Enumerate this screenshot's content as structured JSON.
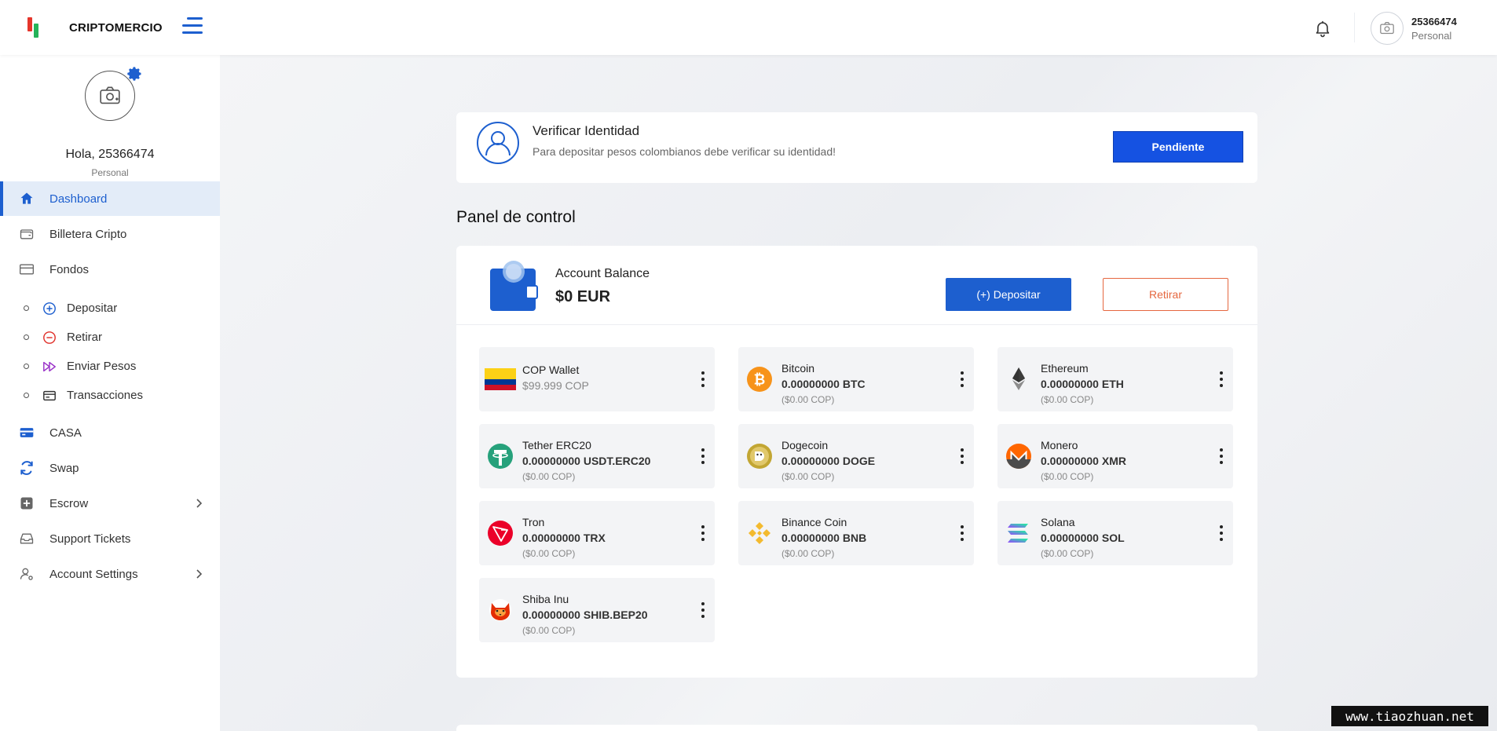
{
  "brand": {
    "name": "CRIPTOMERCIO"
  },
  "topbar": {
    "user_id": "25366474",
    "user_role": "Personal"
  },
  "profile": {
    "greeting": "Hola, 25366474",
    "role": "Personal"
  },
  "sidebar": {
    "items": [
      {
        "label": "Dashboard",
        "icon": "home-icon"
      },
      {
        "label": "Billetera Cripto",
        "icon": "wallet-icon"
      },
      {
        "label": "Fondos",
        "icon": "card-icon"
      }
    ],
    "sub_items": [
      {
        "label": "Depositar",
        "icon": "plus-circle-icon"
      },
      {
        "label": "Retirar",
        "icon": "minus-circle-icon"
      },
      {
        "label": "Enviar Pesos",
        "icon": "fast-forward-icon"
      },
      {
        "label": "Transacciones",
        "icon": "receipt-icon"
      }
    ],
    "lower_items": [
      {
        "label": "CASA",
        "icon": "credit-card-icon"
      },
      {
        "label": "Swap",
        "icon": "refresh-icon"
      },
      {
        "label": "Escrow",
        "icon": "plus-square-icon"
      },
      {
        "label": "Support Tickets",
        "icon": "inbox-icon"
      },
      {
        "label": "Account Settings",
        "icon": "user-settings-icon"
      }
    ]
  },
  "verify": {
    "title": "Verificar Identidad",
    "text": "Para depositar pesos colombianos debe verificar su identidad!",
    "button": "Pendiente"
  },
  "panel": {
    "title": "Panel de control"
  },
  "balance": {
    "label": "Account Balance",
    "value": "$0 EUR",
    "deposit_label": "(+) Depositar",
    "withdraw_label": "Retirar"
  },
  "wallets": [
    {
      "name": "COP Wallet",
      "amount": "$99.999 COP",
      "cop": "",
      "icon": "colombia-flag-icon"
    },
    {
      "name": "Bitcoin",
      "amount": "0.00000000 BTC",
      "cop": "($0.00 COP)",
      "icon": "bitcoin-icon"
    },
    {
      "name": "Ethereum",
      "amount": "0.00000000 ETH",
      "cop": "($0.00 COP)",
      "icon": "ethereum-icon"
    },
    {
      "name": "Tether ERC20",
      "amount": "0.00000000 USDT.ERC20",
      "cop": "($0.00 COP)",
      "icon": "tether-icon"
    },
    {
      "name": "Dogecoin",
      "amount": "0.00000000 DOGE",
      "cop": "($0.00 COP)",
      "icon": "dogecoin-icon"
    },
    {
      "name": "Monero",
      "amount": "0.00000000 XMR",
      "cop": "($0.00 COP)",
      "icon": "monero-icon"
    },
    {
      "name": "Tron",
      "amount": "0.00000000 TRX",
      "cop": "($0.00 COP)",
      "icon": "tron-icon"
    },
    {
      "name": "Binance Coin",
      "amount": "0.00000000 BNB",
      "cop": "($0.00 COP)",
      "icon": "binance-icon"
    },
    {
      "name": "Solana",
      "amount": "0.00000000 SOL",
      "cop": "($0.00 COP)",
      "icon": "solana-icon"
    },
    {
      "name": "Shiba Inu",
      "amount": "0.00000000 SHIB.BEP20",
      "cop": "($0.00 COP)",
      "icon": "shiba-inu-icon"
    }
  ],
  "watermark": "www.tiaozhuan.net",
  "colors": {
    "accent": "#1d5fcf",
    "pending": "#1552e2",
    "withdraw": "#e5673f"
  }
}
